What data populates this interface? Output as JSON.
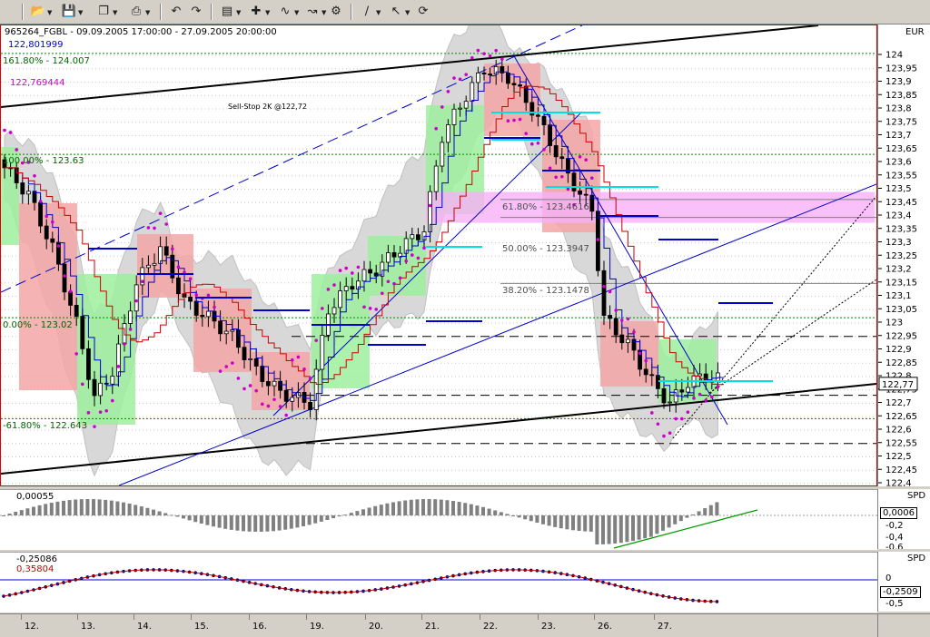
{
  "toolbar": {
    "icons": [
      "open-folder-icon",
      "save-icon",
      "copy-icon",
      "print-icon",
      "undo-icon",
      "chart-type-icon",
      "indicator-icon",
      "drawing-icon",
      "settings-icon",
      "line-tool-icon",
      "cursor-icon",
      "lasso-icon"
    ]
  },
  "main": {
    "header": "965264_FGBL - 09.09.2005 17:00:00 - 27.09.2005 20:00:00",
    "price_label": "122,801999",
    "fib161_label": "161.80% - 124.007",
    "psar_label": "122,769444",
    "sell_stop": "Sell-Stop 2K @122,72",
    "currency": "EUR",
    "fib_labels": {
      "p100": "100.00% - 123.63",
      "p618": "61.80% - 123.4616",
      "p500": "50.00% - 123.3947",
      "p382": "38.20% - 123.1478",
      "p0": "0.00% - 123.02",
      "n618": "-61.80% - 122.643"
    },
    "y_ticks": [
      "124",
      "123,95",
      "123,9",
      "123,85",
      "123,8",
      "123,75",
      "123,7",
      "123,65",
      "123,6",
      "123,55",
      "123,5",
      "123,45",
      "123,4",
      "123,35",
      "123,3",
      "123,25",
      "123,2",
      "123,15",
      "123,1",
      "123,05",
      "123",
      "122,95",
      "122,9",
      "122,85",
      "122,8",
      "122,75",
      "122,7",
      "122,65",
      "122,6",
      "122,55",
      "122,5",
      "122,45",
      "122,4"
    ],
    "current_price": "122,77",
    "colors": {
      "up": "#000000",
      "down": "#000000",
      "bull_zone": "#9ef09e",
      "bear_zone": "#f4a6a6",
      "band": "#d8d8d8",
      "psar": "#cc00cc",
      "ma_red": "#cc0000",
      "ma_blue": "#0000cc",
      "fib_zone": "#f7b0f7"
    }
  },
  "macd": {
    "value_label": "0,00055",
    "unit": "SPD",
    "ticks": [
      "0,0006",
      "-0,2",
      "-0,4",
      "-0,6"
    ]
  },
  "osc": {
    "value_label": "-0,25086",
    "value_label2": "0,35804",
    "unit": "SPD",
    "ticks": [
      "0",
      "-0,2509",
      "-0,5"
    ]
  },
  "dates": [
    "12.",
    "13.",
    "14.",
    "15.",
    "16.",
    "19.",
    "20.",
    "21.",
    "22.",
    "23.",
    "26.",
    "27."
  ]
}
